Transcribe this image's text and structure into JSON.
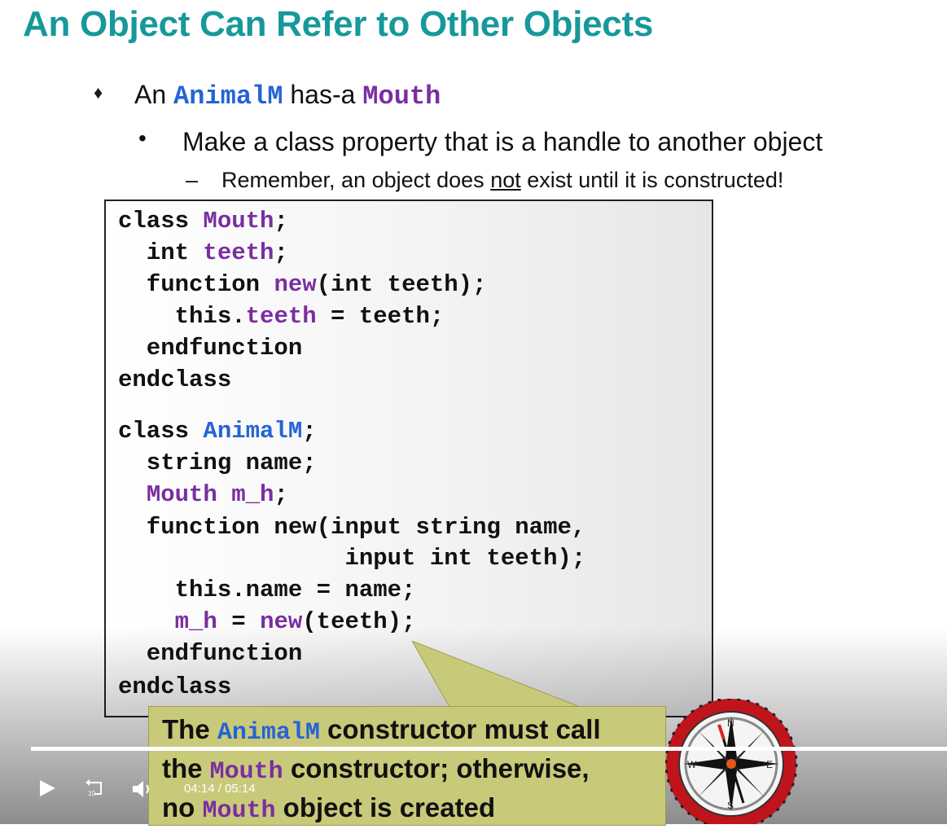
{
  "slide": {
    "title": "An Object Can Refer to Other Objects",
    "bullet1": {
      "pre": "An ",
      "class1": "AnimalM",
      "mid": " has-a ",
      "class2": "Mouth"
    },
    "bullet2": "Make a class property that is a handle to another object",
    "bullet3": {
      "pre": "Remember, an object does ",
      "underlined": "not",
      "post": " exist until it is constructed!"
    }
  },
  "code": {
    "mouth_class": {
      "l1a": "class ",
      "l1b": "Mouth",
      "l1c": ";",
      "l2a": "  int ",
      "l2b": "teeth",
      "l2c": ";",
      "l3a": "  function ",
      "l3b": "new",
      "l3c": "(int teeth);",
      "l4a": "    this.",
      "l4b": "teeth",
      "l4c": " = teeth;",
      "l5": "  endfunction",
      "l6": "endclass"
    },
    "animal_class": {
      "l1a": "class ",
      "l1b": "AnimalM",
      "l1c": ";",
      "l2": "  string name;",
      "l3a": "  ",
      "l3b": "Mouth m_h",
      "l3c": ";",
      "l4": "  function new(input string name,",
      "l5": "                input int teeth);",
      "l6": "    this.name = name;",
      "l7a": "    ",
      "l7b": "m_h",
      "l7c": " = ",
      "l7d": "new",
      "l7e": "(teeth);",
      "l8": "  endfunction",
      "l9": "endclass"
    }
  },
  "callout": {
    "line1a": "The ",
    "line1b": "AnimalM",
    "line1c": " constructor must call",
    "line2a": "the ",
    "line2b": "Mouth",
    "line2c": " constructor; otherwise,",
    "line3a": "no ",
    "line3b": "Mouth",
    "line3c": " object is created"
  },
  "compass": {
    "n": "N",
    "s": "S",
    "e": "E",
    "w": "W"
  },
  "player": {
    "current_time": "04:14",
    "separator": "/",
    "duration": "05:14",
    "progress": 1.0,
    "rewind_label": "10",
    "icons": [
      "play-icon",
      "rewind-10-icon",
      "volume-icon"
    ]
  },
  "colors": {
    "title": "#17989a",
    "blue_keyword": "#2563d6",
    "purple_keyword": "#7a2ea0",
    "callout": "#c9c97a"
  }
}
